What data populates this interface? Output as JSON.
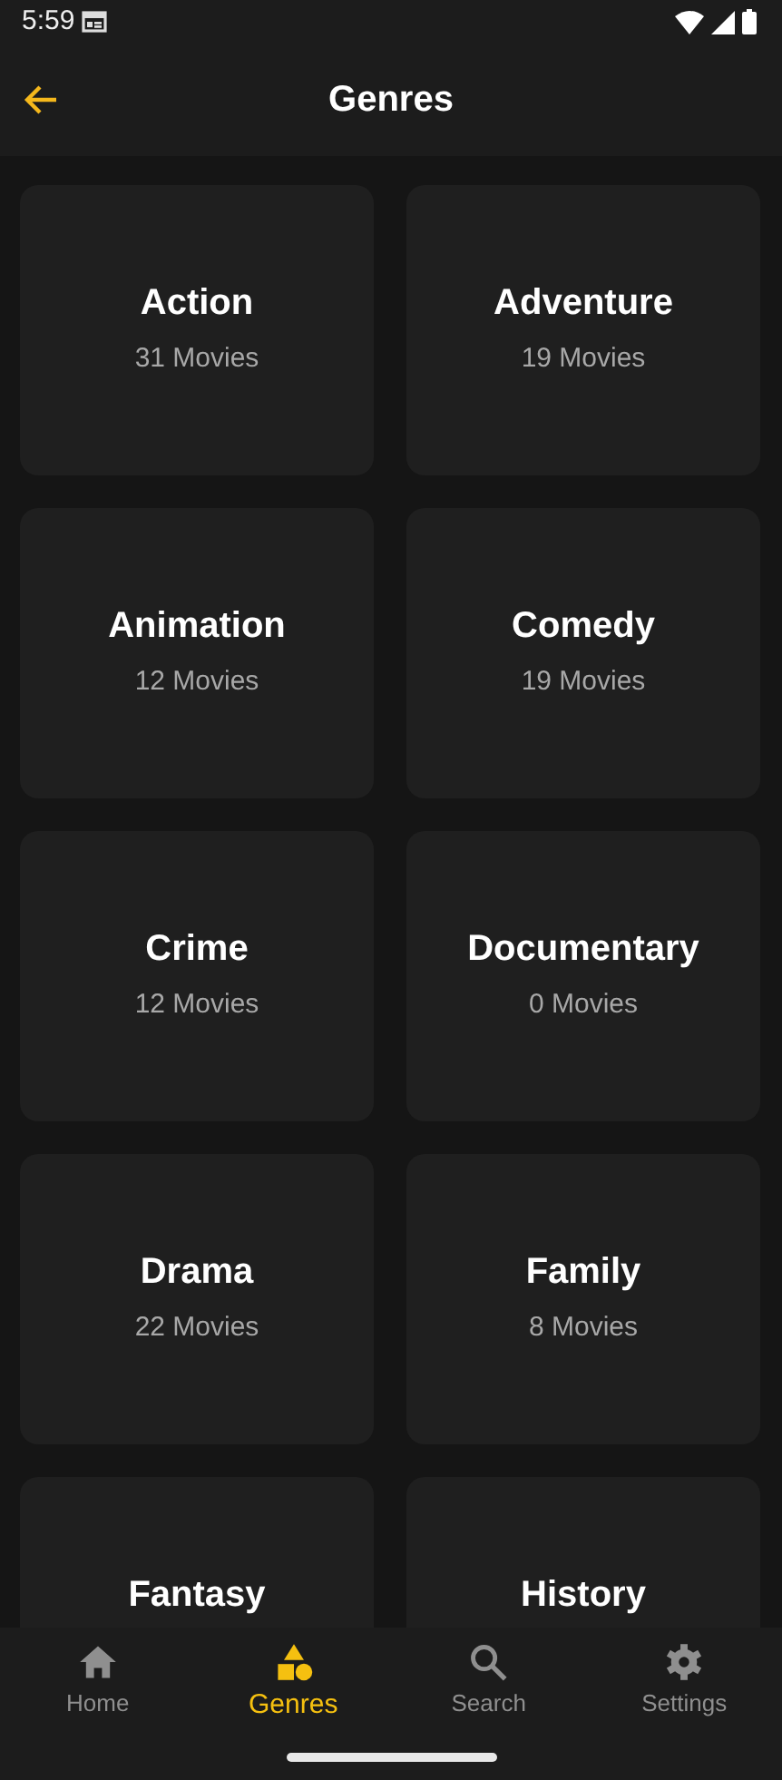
{
  "status_bar": {
    "time": "5:59"
  },
  "app_bar": {
    "title": "Genres"
  },
  "genres": [
    {
      "name": "Action",
      "count": "31 Movies"
    },
    {
      "name": "Adventure",
      "count": "19 Movies"
    },
    {
      "name": "Animation",
      "count": "12 Movies"
    },
    {
      "name": "Comedy",
      "count": "19 Movies"
    },
    {
      "name": "Crime",
      "count": "12 Movies"
    },
    {
      "name": "Documentary",
      "count": "0 Movies"
    },
    {
      "name": "Drama",
      "count": "22 Movies"
    },
    {
      "name": "Family",
      "count": "8 Movies"
    },
    {
      "name": "Fantasy"
    },
    {
      "name": "History"
    }
  ],
  "bottom_nav": [
    {
      "kind": "home",
      "label": "Home",
      "selected": false
    },
    {
      "kind": "genres",
      "label": "Genres",
      "selected": true
    },
    {
      "kind": "search",
      "label": "Search",
      "selected": false
    },
    {
      "kind": "settings",
      "label": "Settings",
      "selected": false
    }
  ]
}
